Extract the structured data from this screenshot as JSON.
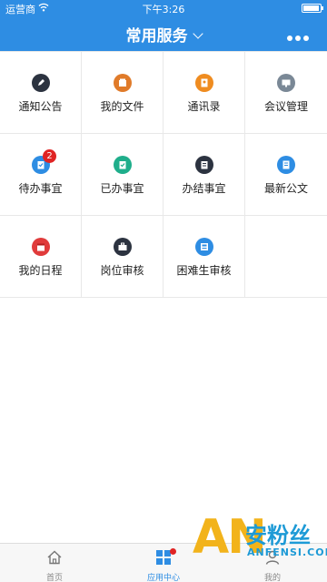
{
  "status_bar": {
    "carrier": "运营商",
    "time": "下午3:26"
  },
  "nav": {
    "title": "常用服务"
  },
  "services": [
    {
      "label": "通知公告",
      "icon": "pen-icon",
      "color": "#2c3340"
    },
    {
      "label": "我的文件",
      "icon": "file-icon",
      "color": "#e07b2a"
    },
    {
      "label": "通讯录",
      "icon": "contacts-icon",
      "color": "#ef8c20"
    },
    {
      "label": "会议管理",
      "icon": "meeting-icon",
      "color": "#7a8896"
    },
    {
      "label": "待办事宜",
      "icon": "todo-icon",
      "color": "#2e8de3",
      "badge": "2"
    },
    {
      "label": "已办事宜",
      "icon": "done-icon",
      "color": "#1fae8b"
    },
    {
      "label": "办结事宜",
      "icon": "finished-icon",
      "color": "#2c3340"
    },
    {
      "label": "最新公文",
      "icon": "document-icon",
      "color": "#2e8de3"
    },
    {
      "label": "我的日程",
      "icon": "calendar-icon",
      "color": "#e03b3b"
    },
    {
      "label": "岗位审核",
      "icon": "briefcase-icon",
      "color": "#2c3340"
    },
    {
      "label": "困难生审核",
      "icon": "review-icon",
      "color": "#2e8de3"
    }
  ],
  "tabs": [
    {
      "label": "首页",
      "icon": "home-icon",
      "active": false
    },
    {
      "label": "应用中心",
      "icon": "apps-icon",
      "active": true
    },
    {
      "label": "我的",
      "icon": "user-icon",
      "active": false
    }
  ],
  "watermark": {
    "letters": "AN",
    "cn": "安粉丝",
    "en": "ANFENSI.COM"
  }
}
